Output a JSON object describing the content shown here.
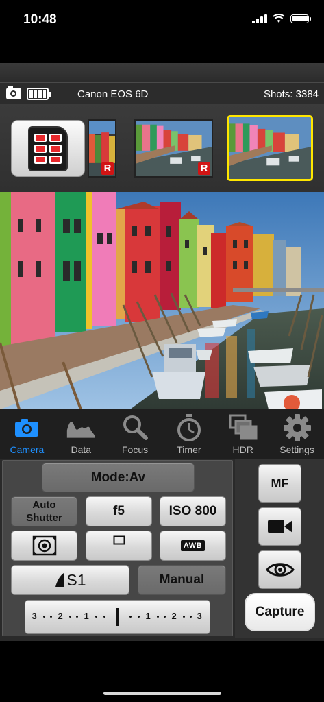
{
  "status_bar": {
    "time": "10:48"
  },
  "camera_bar": {
    "model": "Canon EOS 6D",
    "shots": "Shots: 3384"
  },
  "thumbnails": [
    {
      "badge": "R",
      "selected": false
    },
    {
      "badge": "R",
      "selected": false
    },
    {
      "badge": "",
      "selected": true
    }
  ],
  "tabs": [
    {
      "label": "Camera",
      "icon": "camera-icon",
      "active": true
    },
    {
      "label": "Data",
      "icon": "histogram-icon",
      "active": false
    },
    {
      "label": "Focus",
      "icon": "magnifier-icon",
      "active": false
    },
    {
      "label": "Timer",
      "icon": "stopwatch-icon",
      "active": false
    },
    {
      "label": "HDR",
      "icon": "hdr-icon",
      "active": false
    },
    {
      "label": "Settings",
      "icon": "gear-icon",
      "active": false
    }
  ],
  "controls": {
    "mode": "Mode:Av",
    "auto_shutter_line1": "Auto",
    "auto_shutter_line2": "Shutter",
    "aperture": "f5",
    "iso": "ISO 800",
    "white_balance": "AWB",
    "picture_style": "S1",
    "focus_mode": "Manual",
    "ev_scale": [
      "3",
      "2",
      "1",
      "1",
      "2",
      "3"
    ],
    "mf": "MF",
    "capture": "Capture"
  },
  "colors": {
    "accent": "#1e90ff",
    "selection": "#ffe600",
    "raw_badge": "#d21414"
  }
}
